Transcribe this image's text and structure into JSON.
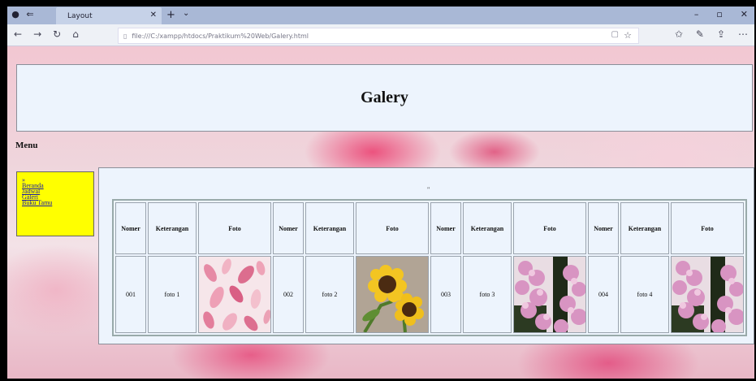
{
  "browser": {
    "tab_title": "Layout",
    "address": "file:///C:/xampp/htdocs/Praktikum%20Web/Galery.html"
  },
  "header": {
    "title": "Galery"
  },
  "menu": {
    "title": "Menu",
    "bullet": "»",
    "items": [
      "Beranda",
      "Jadwal",
      "Galeri",
      "Buku Tamu"
    ]
  },
  "content": {
    "mark": "\""
  },
  "gallery": {
    "headers": [
      "Nomer",
      "Keterangan",
      "Foto"
    ],
    "headers_4": [
      "Nomer",
      "Keterangan",
      "Foto"
    ],
    "rows": [
      {
        "nomer": "001",
        "keterangan": "foto 1",
        "image": "pink-petals"
      },
      {
        "nomer": "002",
        "keterangan": "foto 2",
        "image": "sunflowers"
      },
      {
        "nomer": "003",
        "keterangan": "foto 3",
        "image": "pink-blossom"
      },
      {
        "nomer": "004",
        "keterangan": "foto 4",
        "image": "pink-blossom"
      }
    ]
  },
  "colors": {
    "menu_bg": "#ffff00",
    "panel_bg": "#edf4fd",
    "titlebar": "#a9b8d6"
  }
}
